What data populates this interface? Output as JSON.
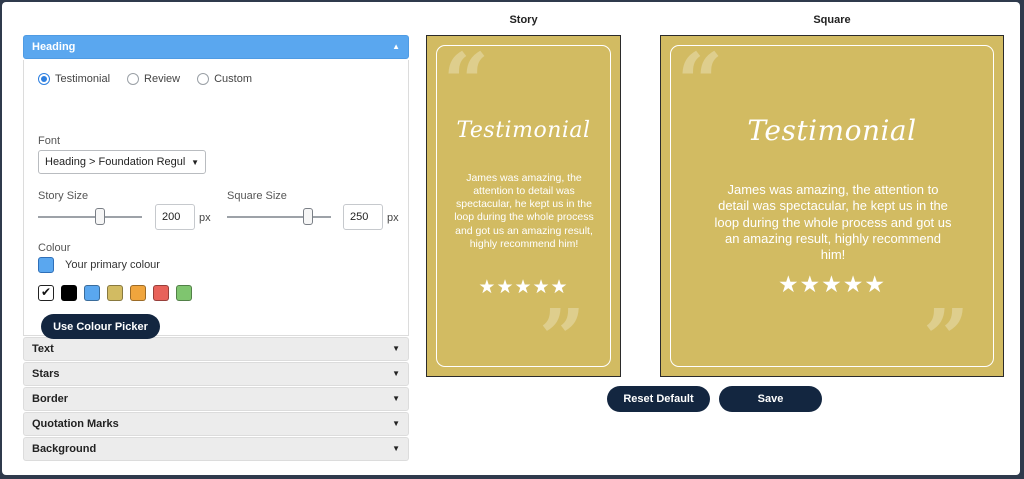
{
  "accordion": {
    "heading_label": "Heading",
    "collapsed": [
      "Text",
      "Stars",
      "Border",
      "Quotation Marks",
      "Background"
    ]
  },
  "heading_panel": {
    "radios": [
      {
        "label": "Testimonial",
        "selected": true
      },
      {
        "label": "Review",
        "selected": false
      },
      {
        "label": "Custom",
        "selected": false
      }
    ],
    "font_label": "Font",
    "font_value": "Heading > Foundation Regular",
    "story_size_label": "Story Size",
    "story_size_value": "200",
    "square_size_label": "Square Size",
    "square_size_value": "250",
    "story_slider_level": 0.6,
    "square_slider_level": 0.78,
    "unit": "px",
    "colour_label": "Colour",
    "primary_colour_label": "Your primary colour",
    "primary_colour": "#5aa7ef",
    "swatches": [
      "#ffffff",
      "#000000",
      "#5aa7ef",
      "#d2bb62",
      "#f0a53d",
      "#e8625a",
      "#7fc56f"
    ],
    "colour_picker_button": "Use Colour Picker"
  },
  "preview": {
    "story_title": "Story",
    "square_title": "Square",
    "card_heading": "Testimonial",
    "card_text": "James was amazing, the attention to detail was spectacular, he kept us in the loop during the whole process and got us an amazing result, highly recommend him!",
    "stars": "★★★★★",
    "open_quote": "“",
    "close_quote": "”",
    "card_color": "#d2bb62"
  },
  "actions": {
    "reset_label": "Reset Default",
    "save_label": "Save"
  }
}
